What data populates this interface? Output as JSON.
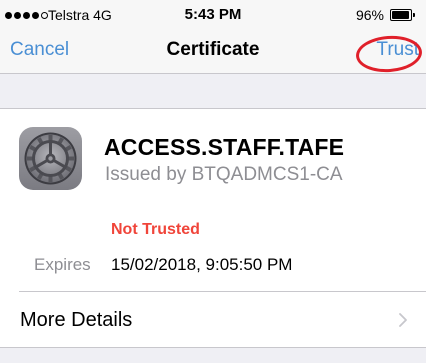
{
  "status_bar": {
    "signal_strength": 4,
    "signal_max": 5,
    "carrier": "Telstra  4G",
    "time": "5:43 PM",
    "battery_text": "96%",
    "battery_level": 0.96
  },
  "nav": {
    "cancel_label": "Cancel",
    "title": "Certificate",
    "trust_label": "Trust",
    "annotation_color": "#e0202a"
  },
  "certificate": {
    "icon": "gear-icon",
    "name": "ACCESS.STAFF.TAFE",
    "issuer": "Issued by BTQADMCS1-CA",
    "trust_status": "Not Trusted",
    "expires_label": "Expires",
    "expires_value": "15/02/2018, 9:05:50 PM"
  },
  "more_details": {
    "label": "More Details",
    "icon": "chevron-right-icon"
  },
  "colors": {
    "accent": "#4a8fd4",
    "warning": "#f0453a",
    "secondary_text": "#8e8e93"
  }
}
